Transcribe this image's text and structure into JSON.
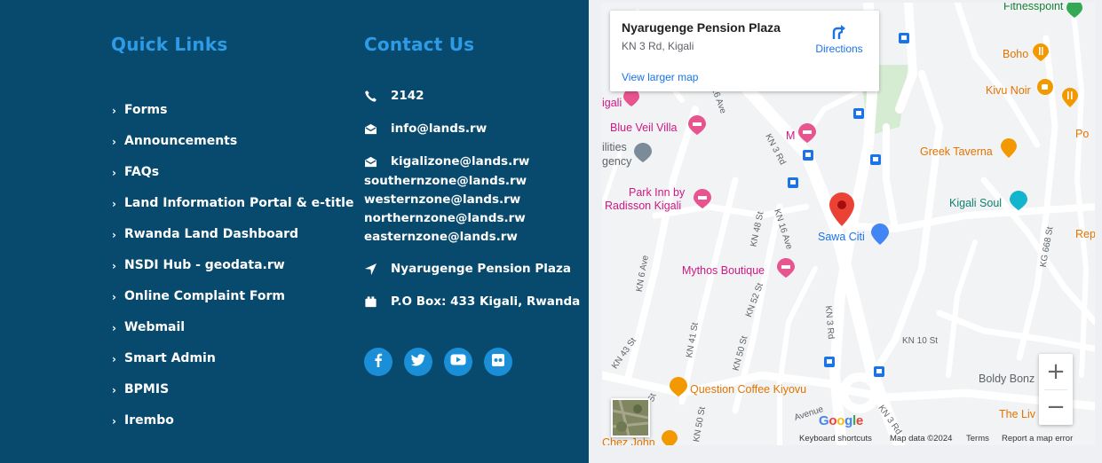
{
  "quick_links": {
    "title": "Quick Links",
    "items": [
      {
        "label": "Forms"
      },
      {
        "label": "Announcements"
      },
      {
        "label": "FAQs"
      },
      {
        "label": "Land Information Portal & e-title"
      },
      {
        "label": "Rwanda Land Dashboard"
      },
      {
        "label": "NSDI Hub - geodata.rw"
      },
      {
        "label": "Online Complaint Form"
      },
      {
        "label": "Webmail"
      },
      {
        "label": "Smart Admin"
      },
      {
        "label": "BPMIS"
      },
      {
        "label": "Irembo"
      }
    ]
  },
  "contact": {
    "title": "Contact Us",
    "phone": "2142",
    "email": "info@lands.rw",
    "zone_emails": [
      "kigalizone@lands.rw",
      "southernzone@lands.rw",
      "westernzone@lands.rw",
      "northernzone@lands.rw",
      "easternzone@lands.rw"
    ],
    "address": "Nyarugenge Pension Plaza",
    "po_box": "P.O Box: 433 Kigali, Rwanda"
  },
  "social": [
    {
      "icon": "facebook-icon",
      "glyph": "f"
    },
    {
      "icon": "twitter-icon",
      "glyph": "t"
    },
    {
      "icon": "youtube-icon",
      "glyph": "▶"
    },
    {
      "icon": "flickr-icon",
      "glyph": "••"
    }
  ],
  "map": {
    "card": {
      "title": "Nyarugenge Pension Plaza",
      "address": "KN 3 Rd, Kigali",
      "directions": "Directions",
      "view_larger": "View larger map"
    },
    "places": {
      "fitnesspoint": "Fitnesspoint",
      "boho": "Boho",
      "kivu_noir": "Kivu Noir",
      "blue_veil": "Blue Veil Villa",
      "m": "M",
      "po": "Po",
      "ilities": "ilities",
      "gency": "gency",
      "greek_taverna": "Greek Taverna",
      "park_inn_1": "Park Inn by",
      "park_inn_2": "Radisson Kigali",
      "kigali_soul": "Kigali Soul",
      "sawa_citi": "Sawa Citi",
      "rep": "Rep",
      "mythos": "Mythos Boutique",
      "question_coffee": "Question Coffee Kiyovu",
      "boldy": "Boldy Bonz",
      "the_liv": "The Liv",
      "chez_john": "Chez John",
      "igali": "igali"
    },
    "streets": {
      "kn16ave_top": "16 Ave",
      "kn3rd_a": "KN 3 Rd",
      "kn48st": "KN 48 St",
      "kn16ave": "KN 16 Ave",
      "kn6ave": "KN 6 Ave",
      "kn52st": "KN 52 St",
      "kn41st": "KN 41 St",
      "kn50st": "KN 50 St",
      "kn43st": "KN 43 St",
      "kn3rd_b": "KN 3 Rd",
      "kn10st": "KN 10 St",
      "kg668st": "KG 668 St",
      "kn3rd_c": "KN 3 Rd",
      "kn50st_b": "KN 50 St",
      "avenue": "Avenue",
      "st": "St"
    },
    "google": "Google",
    "attribution": {
      "shortcuts": "Keyboard shortcuts",
      "data": "Map data ©2024",
      "terms": "Terms",
      "report": "Report a map error"
    },
    "zoom_in": "+",
    "zoom_out": "−"
  },
  "colors": {
    "footer_bg": "#074a6e",
    "heading": "#2d9be6",
    "social": "#1a8fd8",
    "map_link": "#1a73e8",
    "pin_red": "#ea4335",
    "lodging_pink": "#e8548f",
    "food_orange": "#f29900",
    "transit_blue": "#1a73e8"
  }
}
